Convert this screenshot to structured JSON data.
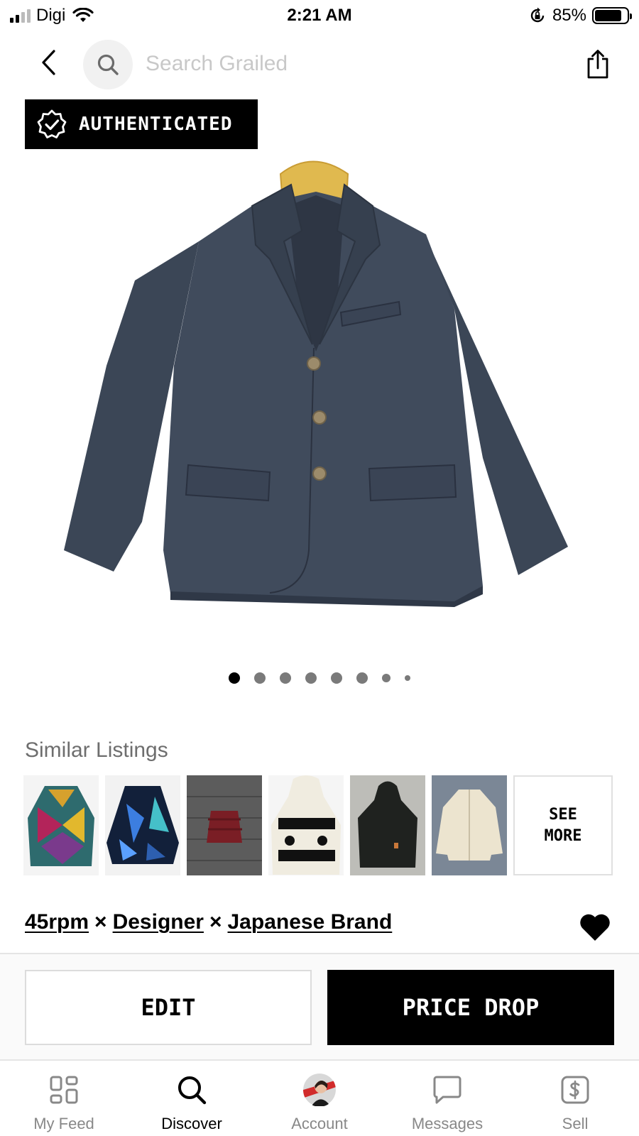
{
  "status_bar": {
    "carrier": "Digi",
    "time": "2:21 AM",
    "battery_percent": "85%",
    "battery_level": 0.85,
    "signal_bars": 2
  },
  "search": {
    "placeholder": "Search Grailed"
  },
  "badge": {
    "label": "AUTHENTICATED"
  },
  "carousel": {
    "total_images": 8,
    "active_index": 0
  },
  "similar": {
    "title": "Similar Listings",
    "see_more": "SEE\nMORE",
    "thumbnails": [
      "multicolor-patterned-knit-coat",
      "blue-abstract-print-jacket",
      "red-puffer-jacket",
      "andre-print-fleece-hoodie",
      "black-hooded-work-jacket",
      "cream-button-jacket"
    ]
  },
  "designers": {
    "items": [
      "45rpm",
      "Designer",
      "Japanese Brand"
    ],
    "separator": "×"
  },
  "actions": {
    "edit": "EDIT",
    "price_drop": "PRICE DROP"
  },
  "tabs": [
    {
      "label": "My Feed",
      "icon": "feed-grid-icon",
      "active": false
    },
    {
      "label": "Discover",
      "icon": "search-icon",
      "active": true
    },
    {
      "label": "Account",
      "icon": "avatar",
      "active": false
    },
    {
      "label": "Messages",
      "icon": "chat-bubble-icon",
      "active": false
    },
    {
      "label": "Sell",
      "icon": "dollar-tag-icon",
      "active": false
    }
  ],
  "colors": {
    "accent": "#000000",
    "muted_text": "#888888",
    "jacket": "#3b4656",
    "hanger": "#e0b94f"
  }
}
